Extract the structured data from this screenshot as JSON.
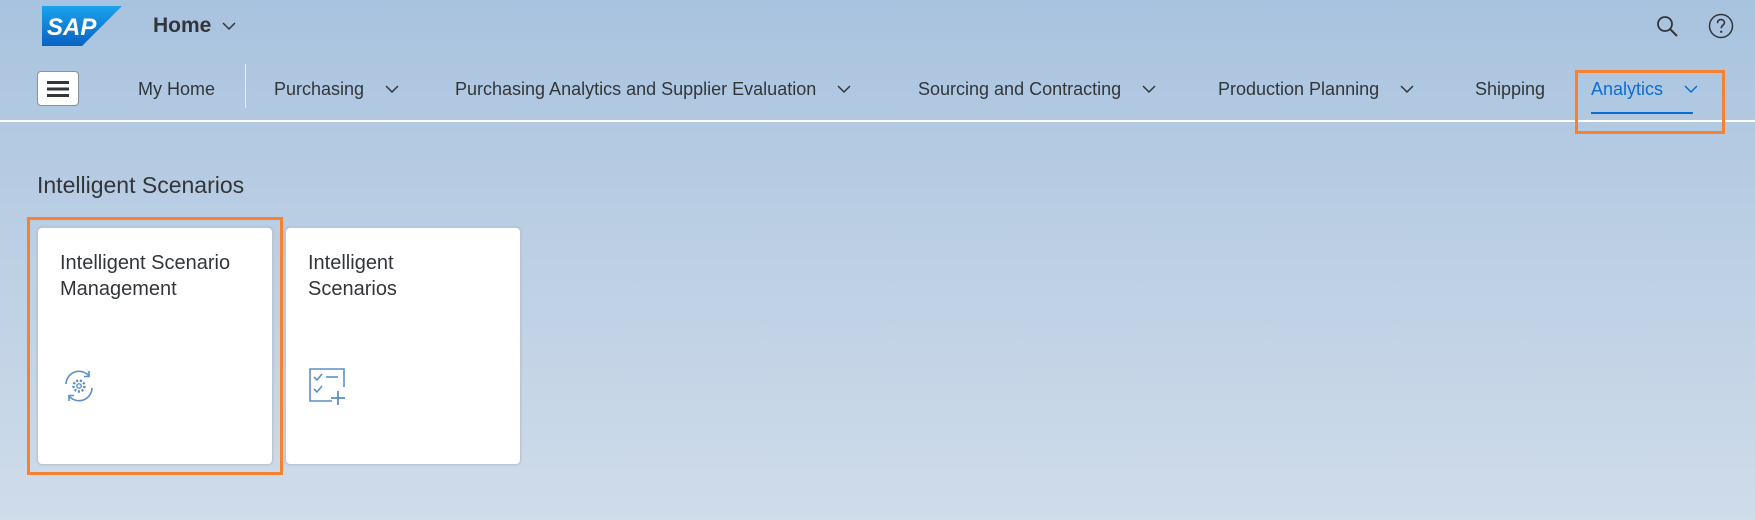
{
  "shell": {
    "logo_text": "SAP",
    "home_title": "Home",
    "icons": {
      "search": "search-icon",
      "help": "help-icon"
    }
  },
  "nav": {
    "menu_icon": "hamburger-menu-icon",
    "items": [
      {
        "label": "My Home",
        "has_dropdown": false
      },
      {
        "label": "Purchasing",
        "has_dropdown": true
      },
      {
        "label": "Purchasing Analytics and Supplier Evaluation",
        "has_dropdown": true
      },
      {
        "label": "Sourcing and Contracting",
        "has_dropdown": true
      },
      {
        "label": "Production Planning",
        "has_dropdown": true
      },
      {
        "label": "Shipping",
        "has_dropdown": false
      },
      {
        "label": "Analytics",
        "has_dropdown": true,
        "active": true
      }
    ]
  },
  "section": {
    "title": "Intelligent Scenarios",
    "tiles": [
      {
        "title": "Intelligent Scenario Management",
        "icon": "gear-refresh-icon"
      },
      {
        "title": "Intelligent Scenarios",
        "icon": "checklist-add-icon"
      }
    ]
  },
  "colors": {
    "accent": "#0a6ed1",
    "highlight": "#f58232",
    "text": "#32363a"
  }
}
